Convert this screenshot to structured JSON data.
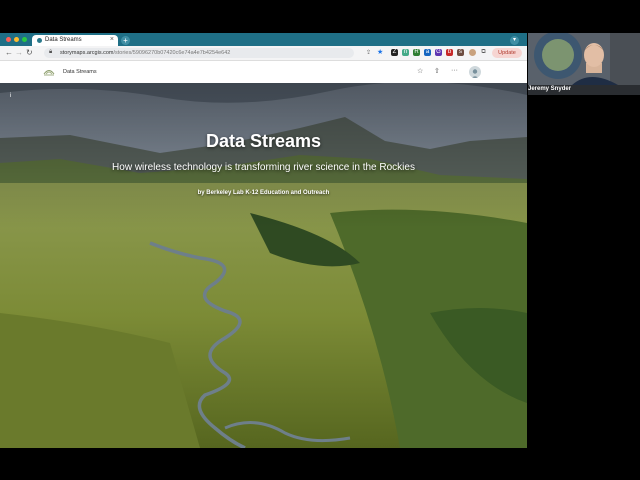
{
  "browser": {
    "tab_title": "Data Streams",
    "tab_close": "×",
    "new_tab": "+",
    "url_host": "storymaps.arcgis.com",
    "url_path": "/stories/59096270b07420c6e74a4e7b4254e642",
    "update_label": "Update",
    "extension_icons": [
      "Z",
      "n",
      "R",
      "a",
      "G",
      "b",
      "s"
    ]
  },
  "site": {
    "name": "Data Streams"
  },
  "hero": {
    "title": "Data Streams",
    "subtitle": "How wireless technology is transforming river science in the Rockies",
    "byline": "by Berkeley Lab K-12 Education and Outreach",
    "info_icon": "i"
  },
  "video": {
    "participant_name": "Jeremy Snyder"
  },
  "colors": {
    "tabbar": "#1f6f86",
    "update_bg": "#f6d5d2",
    "update_text": "#b03a2e"
  }
}
